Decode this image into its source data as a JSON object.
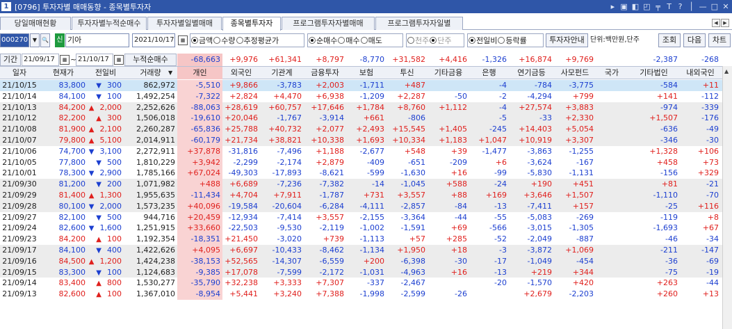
{
  "window": {
    "badge": "1",
    "title": "[0796] 투자자별 매매동향 - 종목별투자자",
    "controls": [
      "▸",
      "▣",
      "◧",
      "◰",
      "╤",
      "T",
      "?",
      "│",
      "—",
      "□",
      "✕"
    ]
  },
  "tabs": [
    {
      "label": "당일매매현황",
      "active": false
    },
    {
      "label": "투자자별누적순매수",
      "active": false
    },
    {
      "label": "투자자별일별매매",
      "active": false
    },
    {
      "label": "종목별투자자",
      "active": true
    },
    {
      "label": "프로그램투자자별매매",
      "active": false
    },
    {
      "label": "프로그램투자자일별",
      "active": false
    }
  ],
  "tab_nav": {
    "prev": "◀",
    "next": "▶"
  },
  "toolbar": {
    "stock_code": "000270",
    "stock_name": "기아",
    "sin_badge": "신",
    "date": "2021/10/17",
    "amount_options": [
      {
        "label": "금액",
        "checked": true
      },
      {
        "label": "수량",
        "checked": false
      },
      {
        "label": "추정평균가",
        "checked": false
      }
    ],
    "trade_options": [
      {
        "label": "순매수",
        "checked": true
      },
      {
        "label": "매수",
        "checked": false
      },
      {
        "label": "매도",
        "checked": false
      }
    ],
    "unit_options": [
      {
        "label": "천주",
        "checked": false,
        "disabled": true
      },
      {
        "label": "단주",
        "checked": true,
        "disabled": true
      }
    ],
    "compare_options": [
      {
        "label": "전일비",
        "checked": true
      },
      {
        "label": "등락률",
        "checked": false
      }
    ],
    "investor_guide_button": "투자자안내",
    "unit_label": "단위:백만원,단주",
    "query_button": "조회",
    "next_button": "다음",
    "chart_button": "차트"
  },
  "period": {
    "label": "기간",
    "from": "21/09/17",
    "to": "21/10/17",
    "tilde": "~",
    "cumulative_label": "누적순매수",
    "sums": [
      "-68,663",
      "+9,976",
      "+61,341",
      "+8,797",
      "-8,770",
      "+31,582",
      "+4,416",
      "-1,326",
      "+16,874",
      "+9,769",
      "",
      "-2,387",
      "-268"
    ]
  },
  "columns": [
    "일자",
    "현재가",
    "전일비",
    "거래량",
    "개인",
    "외국인",
    "기관계",
    "금융투자",
    "보험",
    "투신",
    "기타금융",
    "은행",
    "연기금등",
    "사모펀드",
    "국가",
    "기타법인",
    "내외국인"
  ],
  "rows": [
    {
      "date": "21/10/15",
      "price": "83,800",
      "dir": "down",
      "change": "300",
      "volume": "862,972",
      "vals": [
        "-5,510",
        "+9,866",
        "-3,783",
        "+2,003",
        "-1,711",
        "+487",
        "",
        "-4",
        "-784",
        "-3,775",
        "",
        "-584",
        "+11"
      ]
    },
    {
      "date": "21/10/14",
      "price": "84,100",
      "dir": "down",
      "change": "100",
      "volume": "1,492,254",
      "vals": [
        "-7,322",
        "+2,824",
        "+4,470",
        "+6,938",
        "-1,209",
        "+2,287",
        "-50",
        "-2",
        "-4,294",
        "+799",
        "",
        "+141",
        "-112"
      ]
    },
    {
      "date": "21/10/13",
      "price": "84,200",
      "dir": "up",
      "change": "2,000",
      "volume": "2,252,626",
      "vals": [
        "-88,063",
        "+28,619",
        "+60,757",
        "+17,646",
        "+1,784",
        "+8,760",
        "+1,112",
        "-4",
        "+27,574",
        "+3,883",
        "",
        "-974",
        "-339"
      ]
    },
    {
      "date": "21/10/12",
      "price": "82,200",
      "dir": "up",
      "change": "300",
      "volume": "1,506,018",
      "vals": [
        "-19,610",
        "+20,046",
        "-1,767",
        "-3,914",
        "+661",
        "-806",
        "",
        "-5",
        "-33",
        "+2,330",
        "",
        "+1,507",
        "-176"
      ]
    },
    {
      "date": "21/10/08",
      "price": "81,900",
      "dir": "up",
      "change": "2,100",
      "volume": "2,260,287",
      "vals": [
        "-65,836",
        "+25,788",
        "+40,732",
        "+2,077",
        "+2,493",
        "+15,545",
        "+1,405",
        "-245",
        "+14,403",
        "+5,054",
        "",
        "-636",
        "-49"
      ]
    },
    {
      "date": "21/10/07",
      "price": "79,800",
      "dir": "up",
      "change": "5,100",
      "volume": "2,014,911",
      "vals": [
        "-60,179",
        "+21,734",
        "+38,821",
        "+10,338",
        "+1,693",
        "+10,334",
        "+1,183",
        "+1,047",
        "+10,919",
        "+3,307",
        "",
        "-346",
        "-30"
      ]
    },
    {
      "date": "21/10/06",
      "price": "74,700",
      "dir": "down",
      "change": "3,100",
      "volume": "2,272,911",
      "vals": [
        "+37,878",
        "-31,816",
        "-7,496",
        "+1,188",
        "-2,677",
        "+548",
        "+39",
        "-1,477",
        "-3,863",
        "-1,255",
        "",
        "+1,328",
        "+106"
      ]
    },
    {
      "date": "21/10/05",
      "price": "77,800",
      "dir": "down",
      "change": "500",
      "volume": "1,810,229",
      "vals": [
        "+3,942",
        "-2,299",
        "-2,174",
        "+2,879",
        "-409",
        "-651",
        "-209",
        "+6",
        "-3,624",
        "-167",
        "",
        "+458",
        "+73"
      ]
    },
    {
      "date": "21/10/01",
      "price": "78,300",
      "dir": "down",
      "change": "2,900",
      "volume": "1,785,166",
      "vals": [
        "+67,024",
        "-49,303",
        "-17,893",
        "-8,621",
        "-599",
        "-1,630",
        "+16",
        "-99",
        "-5,830",
        "-1,131",
        "",
        "-156",
        "+329"
      ]
    },
    {
      "date": "21/09/30",
      "price": "81,200",
      "dir": "down",
      "change": "200",
      "volume": "1,071,982",
      "vals": [
        "+488",
        "+6,689",
        "-7,236",
        "-7,382",
        "-14",
        "-1,045",
        "+588",
        "-24",
        "+190",
        "+451",
        "",
        "+81",
        "-21"
      ]
    },
    {
      "date": "21/09/29",
      "price": "81,400",
      "dir": "up",
      "change": "1,300",
      "volume": "1,955,635",
      "vals": [
        "-11,434",
        "+4,704",
        "+7,911",
        "-1,787",
        "+731",
        "+3,557",
        "+88",
        "+169",
        "+3,646",
        "+1,507",
        "",
        "-1,110",
        "-70"
      ]
    },
    {
      "date": "21/09/28",
      "price": "80,100",
      "dir": "down",
      "change": "2,000",
      "volume": "1,573,235",
      "vals": [
        "+40,096",
        "-19,584",
        "-20,604",
        "-6,284",
        "-4,111",
        "-2,857",
        "-84",
        "-13",
        "-7,411",
        "+157",
        "",
        "-25",
        "+116"
      ]
    },
    {
      "date": "21/09/27",
      "price": "82,100",
      "dir": "down",
      "change": "500",
      "volume": "944,716",
      "vals": [
        "+20,459",
        "-12,934",
        "-7,414",
        "+3,557",
        "-2,155",
        "-3,364",
        "-44",
        "-55",
        "-5,083",
        "-269",
        "",
        "-119",
        "+8"
      ]
    },
    {
      "date": "21/09/24",
      "price": "82,600",
      "dir": "down",
      "change": "1,600",
      "volume": "1,251,915",
      "vals": [
        "+33,660",
        "-22,503",
        "-9,530",
        "-2,119",
        "-1,002",
        "-1,591",
        "+69",
        "-566",
        "-3,015",
        "-1,305",
        "",
        "-1,693",
        "+67"
      ]
    },
    {
      "date": "21/09/23",
      "price": "84,200",
      "dir": "up",
      "change": "100",
      "volume": "1,192,354",
      "vals": [
        "-18,351",
        "+21,450",
        "-3,020",
        "+739",
        "-1,113",
        "+57",
        "+285",
        "-52",
        "-2,049",
        "-887",
        "",
        "-46",
        "-34"
      ]
    },
    {
      "date": "21/09/17",
      "price": "84,100",
      "dir": "down",
      "change": "400",
      "volume": "1,422,626",
      "vals": [
        "+4,095",
        "+6,697",
        "-10,433",
        "-8,462",
        "-1,134",
        "+1,950",
        "+18",
        "-3",
        "-3,872",
        "+1,069",
        "",
        "-211",
        "-147"
      ]
    },
    {
      "date": "21/09/16",
      "price": "84,500",
      "dir": "up",
      "change": "1,200",
      "volume": "1,424,238",
      "vals": [
        "-38,153",
        "+52,565",
        "-14,307",
        "-6,559",
        "+200",
        "-6,398",
        "-30",
        "-17",
        "-1,049",
        "-454",
        "",
        "-36",
        "-69"
      ]
    },
    {
      "date": "21/09/15",
      "price": "83,300",
      "dir": "down",
      "change": "100",
      "volume": "1,124,683",
      "vals": [
        "-9,385",
        "+17,078",
        "-7,599",
        "-2,172",
        "-1,031",
        "-4,963",
        "+16",
        "-13",
        "+219",
        "+344",
        "",
        "-75",
        "-19"
      ]
    },
    {
      "date": "21/09/14",
      "price": "83,400",
      "dir": "up",
      "change": "800",
      "volume": "1,530,277",
      "vals": [
        "-35,790",
        "+32,238",
        "+3,333",
        "+7,307",
        "-337",
        "-2,467",
        "",
        "-20",
        "-1,570",
        "+420",
        "",
        "+263",
        "-44"
      ]
    },
    {
      "date": "21/09/13",
      "price": "82,600",
      "dir": "up",
      "change": "100",
      "volume": "1,367,010",
      "vals": [
        "-8,954",
        "+5,441",
        "+3,240",
        "+7,388",
        "-1,998",
        "-2,599",
        "-26",
        "",
        "+2,679",
        "-2,203",
        "",
        "+260",
        "+13"
      ]
    }
  ],
  "colors": {
    "up": "#e0201d",
    "down": "#1c3fd0",
    "title_bar": "#2f56a8",
    "selected_row": "#cfe6f7",
    "highlight_col": "#f9d3d3"
  }
}
